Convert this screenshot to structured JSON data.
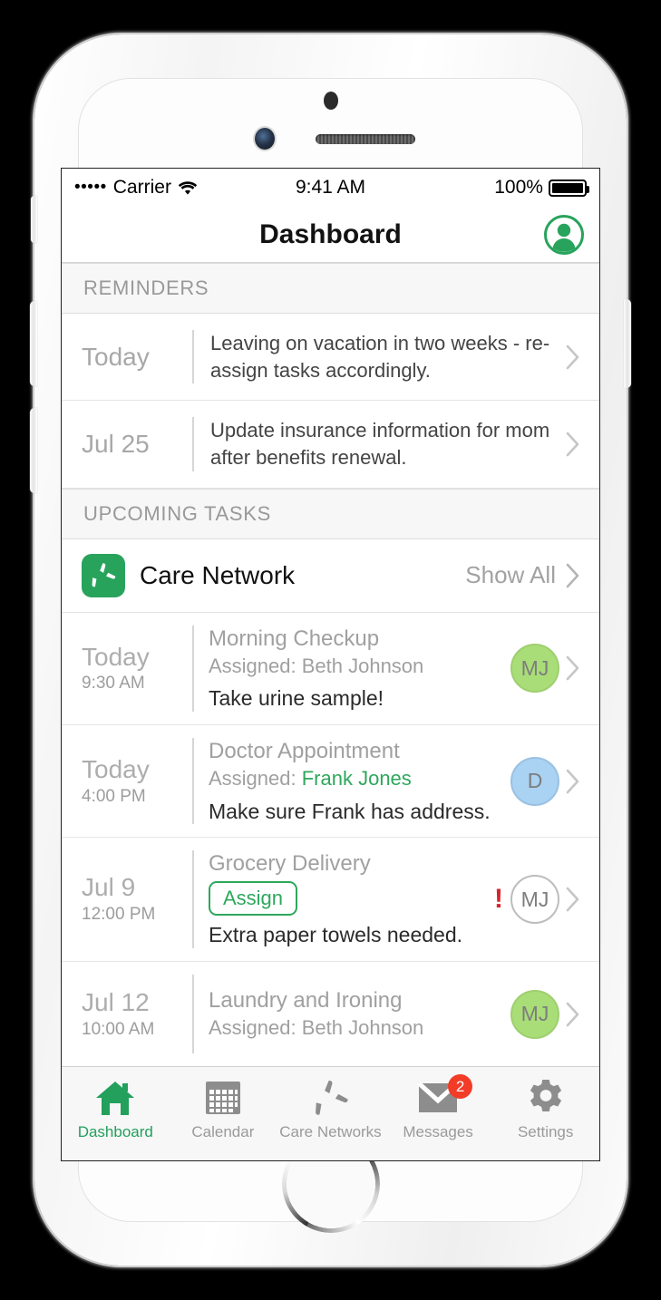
{
  "status_bar": {
    "signal_dots": "•••••",
    "carrier": "Carrier",
    "wifi_icon": "wifi-icon",
    "time": "9:41 AM",
    "battery_percent": "100%",
    "battery_icon": "battery-full-icon"
  },
  "nav_bar": {
    "title": "Dashboard",
    "profile_icon": "profile-avatar-icon"
  },
  "sections": {
    "reminders_header": "REMINDERS",
    "upcoming_tasks_header": "UPCOMING TASKS"
  },
  "reminders": [
    {
      "date": "Today",
      "text": "Leaving on vacation in two weeks - re-assign tasks accordingly."
    },
    {
      "date": "Jul 25",
      "text": "Update insurance information for mom after benefits renewal."
    }
  ],
  "care_network": {
    "logo_icon": "care-network-pinwheel-logo",
    "name": "Care Network",
    "show_all_label": "Show All",
    "chevron_icon": "chevron-right-icon"
  },
  "tasks": [
    {
      "date": "Today",
      "time": "9:30 AM",
      "title": "Morning Checkup",
      "assigned_prefix": "Assigned: ",
      "assignee": "Beth Johnson",
      "assignee_highlighted": false,
      "note": "Take urine sample!",
      "has_assign_button": false,
      "assign_label": "",
      "alert": false,
      "avatar_initials": "MJ",
      "avatar_style": "green"
    },
    {
      "date": "Today",
      "time": "4:00 PM",
      "title": "Doctor Appointment",
      "assigned_prefix": "Assigned: ",
      "assignee": "Frank Jones",
      "assignee_highlighted": true,
      "note": "Make sure Frank has address.",
      "has_assign_button": false,
      "assign_label": "",
      "alert": false,
      "avatar_initials": "D",
      "avatar_style": "blue"
    },
    {
      "date": "Jul 9",
      "time": "12:00 PM",
      "title": "Grocery Delivery",
      "assigned_prefix": "",
      "assignee": "",
      "assignee_highlighted": false,
      "note": "Extra paper towels needed.",
      "has_assign_button": true,
      "assign_label": "Assign",
      "alert": true,
      "alert_icon": "!",
      "avatar_initials": "MJ",
      "avatar_style": "empty"
    },
    {
      "date": "Jul 12",
      "time": "10:00 AM",
      "title": "Laundry and Ironing",
      "assigned_prefix": "Assigned: ",
      "assignee": "Beth Johnson",
      "assignee_highlighted": false,
      "note": "",
      "has_assign_button": false,
      "assign_label": "",
      "alert": false,
      "avatar_initials": "MJ",
      "avatar_style": "green"
    }
  ],
  "tab_bar": [
    {
      "label": "Dashboard",
      "icon": "home-icon",
      "active": true,
      "badge": ""
    },
    {
      "label": "Calendar",
      "icon": "calendar-icon",
      "active": false,
      "badge": ""
    },
    {
      "label": "Care Networks",
      "icon": "pinwheel-icon",
      "active": false,
      "badge": ""
    },
    {
      "label": "Messages",
      "icon": "envelope-icon",
      "active": false,
      "badge": "2"
    },
    {
      "label": "Settings",
      "icon": "gear-icon",
      "active": false,
      "badge": ""
    }
  ],
  "colors": {
    "brand_green": "#28a35c",
    "accent_green": "#2ea75c",
    "alert_red": "#d9232d",
    "badge_red": "#f23c28",
    "avatar_green": "#a9dd78",
    "avatar_blue": "#a9d2f3"
  }
}
